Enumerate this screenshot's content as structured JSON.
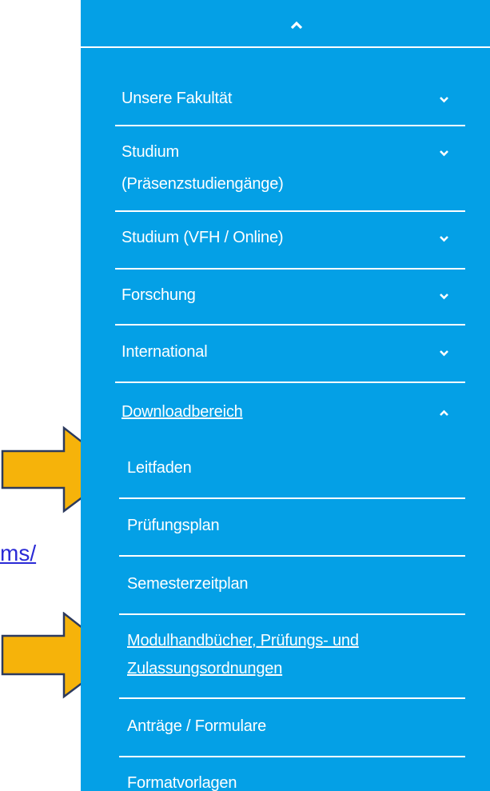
{
  "left_link_fragment": "ms/",
  "menu": [
    {
      "label": "Unsere Fakultät",
      "expanded": false
    },
    {
      "label_lines": [
        "Studium",
        "(Präsenzstudiengänge)"
      ],
      "expanded": false
    },
    {
      "label": "Studium (VFH / Online)",
      "expanded": false
    },
    {
      "label": "Forschung",
      "expanded": false
    },
    {
      "label": "International",
      "expanded": false
    },
    {
      "label": "Downloadbereich",
      "expanded": true
    }
  ],
  "submenu": [
    {
      "label": "Leitfaden",
      "highlighted": true
    },
    {
      "label": "Prüfungsplan"
    },
    {
      "label": "Semesterzeitplan"
    },
    {
      "label_lines": [
        "Modulhandbücher, Prüfungs- und",
        "Zulassungsordnungen"
      ],
      "highlighted": true
    },
    {
      "label": "Anträge / Formulare"
    },
    {
      "label": "Formatvorlagen"
    }
  ],
  "colors": {
    "nav_background": "#04a0e6",
    "nav_text": "#ffffff",
    "annotation_arrow_fill": "#f6b30a",
    "annotation_arrow_stroke": "#2c3a5e",
    "link": "#2a2ad6"
  }
}
